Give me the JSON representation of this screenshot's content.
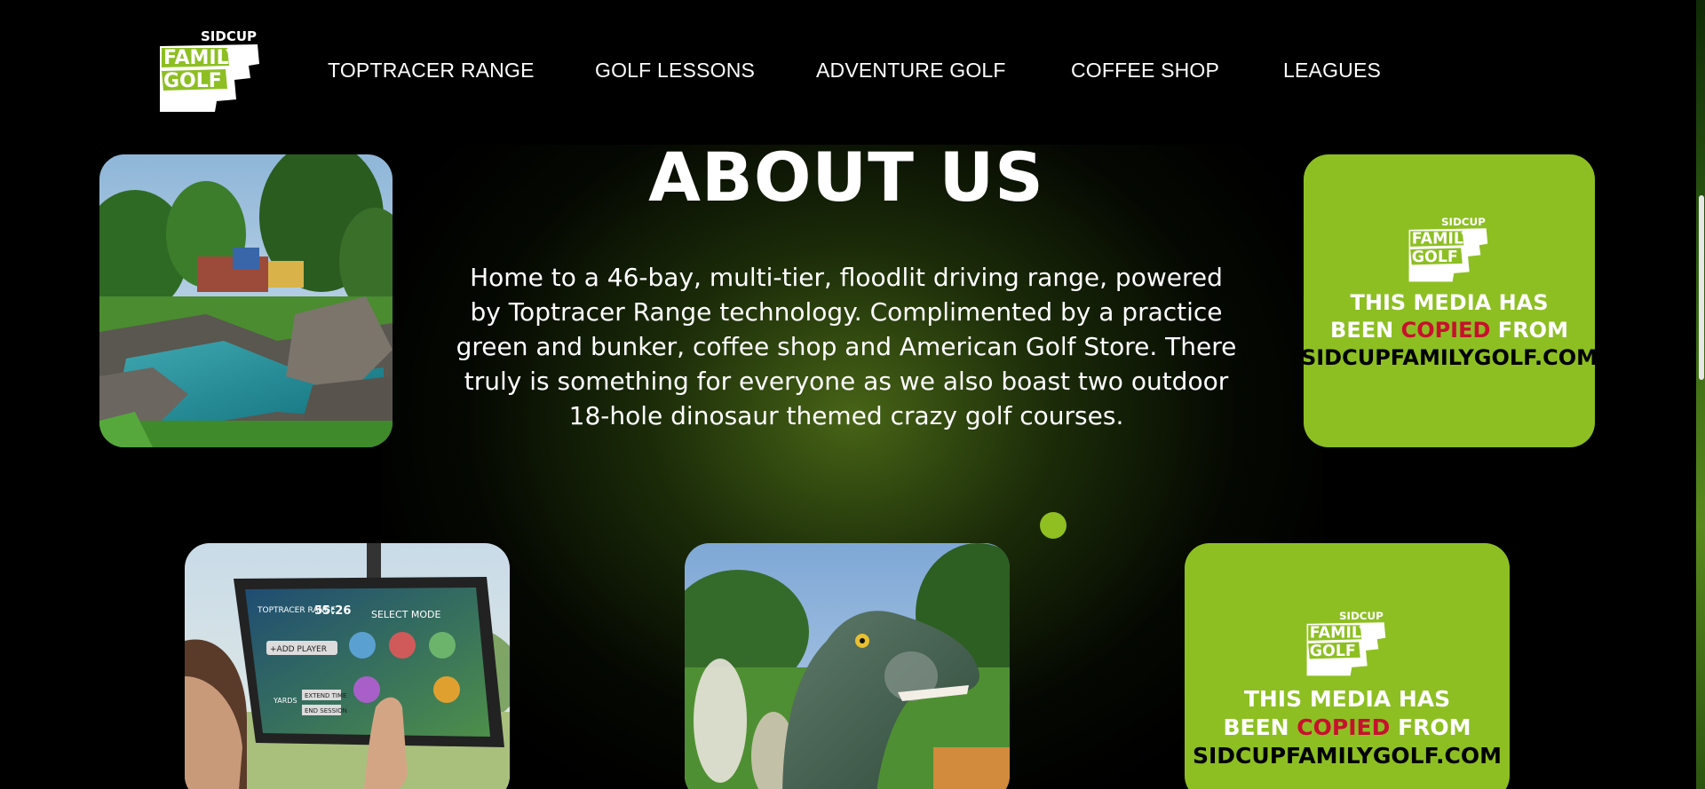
{
  "nav": {
    "items": [
      {
        "label": "TOPTRACER RANGE"
      },
      {
        "label": "GOLF LESSONS"
      },
      {
        "label": "ADVENTURE GOLF"
      },
      {
        "label": "COFFEE SHOP"
      },
      {
        "label": "LEAGUES"
      }
    ]
  },
  "logo": {
    "top_text": "SIDCUP",
    "line1": "FAMILY",
    "line2": "GOLF"
  },
  "about": {
    "title": "ABOUT US",
    "text": "Home to a 46-bay, multi-tier, floodlit driving range, powered by Toptracer Range technology. Complimented by a practice green and bunker, coffee shop and American Golf Store. There truly is something for everyone as we also boast two outdoor 18-hole dinosaur themed crazy golf courses."
  },
  "media_notice": {
    "line1": "THIS MEDIA HAS",
    "line2_a": "BEEN ",
    "line2_b": "COPIED",
    "line2_c": " FROM",
    "line3": "SIDCUPFAMILYGOLF.COM"
  },
  "toptracer_screen": {
    "brand": "TOPTRACER RANGE",
    "time": "55:26",
    "mode": "SELECT MODE",
    "add_player": "+ADD PLAYER",
    "yards": "YARDS",
    "extend": "EXTEND TIME",
    "end": "END SESSION"
  },
  "colors": {
    "accent_green": "#8dbf23",
    "copied_red": "#c8102e",
    "background": "#000000"
  }
}
